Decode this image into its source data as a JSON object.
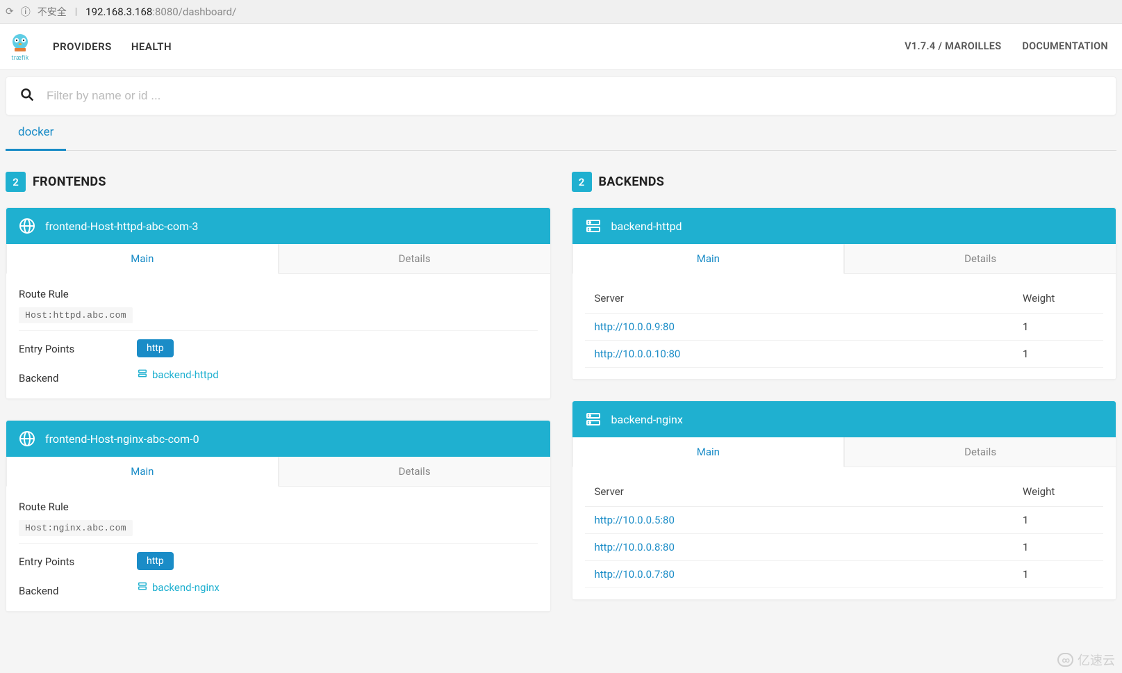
{
  "browser": {
    "not_secure_label": "不安全",
    "url_host": "192.168.3.168",
    "url_port_path": ":8080/dashboard/"
  },
  "navbar": {
    "logo_text": "træfik",
    "providers": "PROVIDERS",
    "health": "HEALTH",
    "version": "V1.7.4 / MAROILLES",
    "documentation": "DOCUMENTATION"
  },
  "search": {
    "placeholder": "Filter by name or id ..."
  },
  "provider_tab": "docker",
  "frontends": {
    "count": "2",
    "title": "FRONTENDS",
    "labels": {
      "route_rule": "Route Rule",
      "entry_points": "Entry Points",
      "backend": "Backend",
      "main_tab": "Main",
      "details_tab": "Details"
    },
    "items": [
      {
        "name": "frontend-Host-httpd-abc-com-3",
        "route_rule": "Host:httpd.abc.com",
        "entry_point": "http",
        "backend": "backend-httpd"
      },
      {
        "name": "frontend-Host-nginx-abc-com-0",
        "route_rule": "Host:nginx.abc.com",
        "entry_point": "http",
        "backend": "backend-nginx"
      }
    ]
  },
  "backends": {
    "count": "2",
    "title": "BACKENDS",
    "labels": {
      "server": "Server",
      "weight": "Weight",
      "main_tab": "Main",
      "details_tab": "Details"
    },
    "items": [
      {
        "name": "backend-httpd",
        "servers": [
          {
            "url": "http://10.0.0.9:80",
            "weight": "1"
          },
          {
            "url": "http://10.0.0.10:80",
            "weight": "1"
          }
        ]
      },
      {
        "name": "backend-nginx",
        "servers": [
          {
            "url": "http://10.0.0.5:80",
            "weight": "1"
          },
          {
            "url": "http://10.0.0.8:80",
            "weight": "1"
          },
          {
            "url": "http://10.0.0.7:80",
            "weight": "1"
          }
        ]
      }
    ]
  },
  "watermark": "亿速云"
}
